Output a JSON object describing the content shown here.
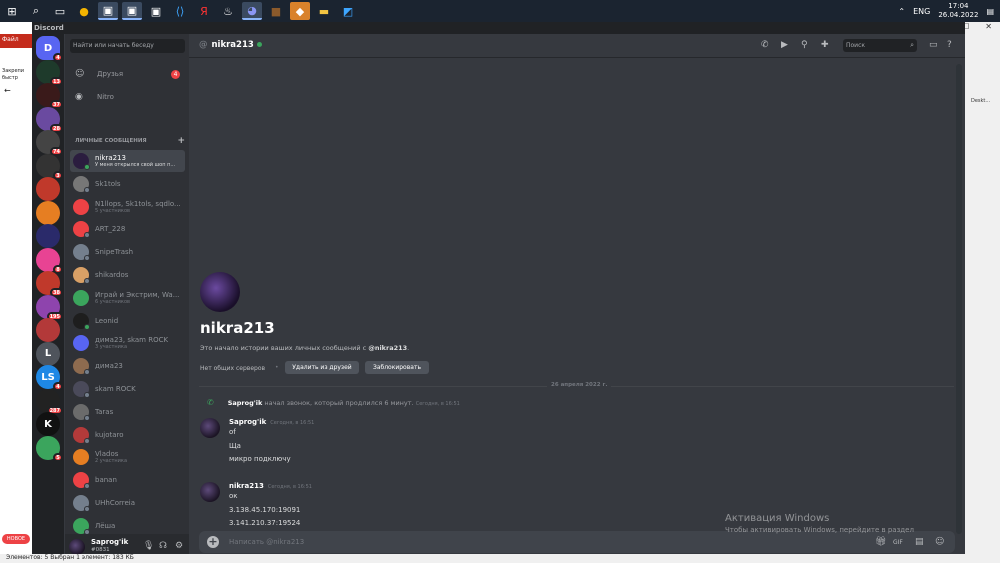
{
  "taskbar": {
    "lang": "ENG",
    "time": "17:04",
    "date": "26.04.2022"
  },
  "explorer": {
    "file_tab": "Файл",
    "pin_text": "Закрепи быстр",
    "bottom_text": "Элементов: 5  Выбран 1 элемент: 183 КБ",
    "right_text": "Deskt..."
  },
  "discord": {
    "app_title": "Discord",
    "search_placeholder": "Найти или начать беседу",
    "nav": [
      {
        "label": "Друзья",
        "badge": "4"
      },
      {
        "label": "Nitro"
      }
    ],
    "dm_header": "ЛИЧНЫЕ СООБЩЕНИЯ",
    "dms": [
      {
        "name": "nikra213",
        "sub": "У меня открылся свой шоп п...",
        "color": "#2b1d3f",
        "online": true,
        "selected": true
      },
      {
        "name": "Sk1tols",
        "sub": "",
        "color": "#777777",
        "online": false
      },
      {
        "name": "N1llops, Sk1tols, sqdlo...",
        "sub": "5 участников",
        "color": "#ed4245"
      },
      {
        "name": "ART_228",
        "sub": "",
        "color": "#ed4245",
        "online": false
      },
      {
        "name": "SnipeTrash",
        "sub": "",
        "color": "#747f8d",
        "online": false
      },
      {
        "name": "shikardos",
        "sub": "",
        "color": "#d9a066",
        "online": false
      },
      {
        "name": "Играй и Экстрим, Wa...",
        "sub": "6 участников",
        "color": "#3ba55d"
      },
      {
        "name": "Leonid",
        "sub": "",
        "color": "#1e1e1e",
        "online": true
      },
      {
        "name": "дима23, skam ROCK",
        "sub": "3 участника",
        "color": "#5865f2"
      },
      {
        "name": "дима23",
        "sub": "",
        "color": "#8e6b4f",
        "online": false
      },
      {
        "name": "skam ROCK",
        "sub": "",
        "color": "#4a4a5a",
        "online": false
      },
      {
        "name": "Taras",
        "sub": "",
        "color": "#6b6b6b",
        "online": false
      },
      {
        "name": "kujotaro",
        "sub": "",
        "color": "#b33a3a",
        "online": false
      },
      {
        "name": "Vlados",
        "sub": "2 участника",
        "color": "#e67e22"
      },
      {
        "name": "banan",
        "sub": "",
        "color": "#ed4245",
        "online": false
      },
      {
        "name": "UHhCorreia",
        "sub": "",
        "color": "#747f8d",
        "online": false
      },
      {
        "name": "Лёша",
        "sub": "",
        "color": "#3ba55d",
        "online": false
      },
      {
        "name": "JuniperBot",
        "sub": "",
        "color": "#e67e22",
        "online": false
      }
    ],
    "guild_badges": [
      "4",
      "13",
      "37",
      "28",
      "74",
      "3",
      "",
      "",
      "",
      "8",
      "38",
      "195",
      "",
      "",
      "4",
      "287",
      "",
      "5"
    ],
    "new_badge": "НОВОЕ",
    "user": {
      "name": "Saprog'ik",
      "tag": "#0831"
    },
    "chat": {
      "at": "@",
      "title": "nikra213",
      "header_search": "Поиск",
      "intro_name": "nikra213",
      "intro_text_prefix": "Это начало истории ваших личных сообщений с ",
      "intro_text_user": "@nikra213",
      "intro_text_suffix": ".",
      "no_servers": "Нет общих серверов",
      "btn_remove": "Удалить из друзей",
      "btn_block": "Заблокировать",
      "date_divider": "26 апреля 2022 г.",
      "call": {
        "author": "Saprog'ik",
        "text": " начал звонок, который продлился 6 минут.",
        "ts": "Сегодня, в 16:51"
      },
      "messages": [
        {
          "author": "Saprog'ik",
          "ts": "Сегодня, в 16:51",
          "lines": [
            "of",
            "Ща",
            "микро подключу"
          ]
        },
        {
          "author": "nikra213",
          "ts": "Сегодня, в 16:51",
          "lines": [
            "ок",
            "3.138.45.170:19091",
            "3.141.210.37:19524"
          ]
        }
      ],
      "composer_placeholder": "Написать @nikra213"
    },
    "watermark_title": "Активация Windows",
    "watermark_text": "Чтобы активировать Windows, перейдите в раздел"
  }
}
